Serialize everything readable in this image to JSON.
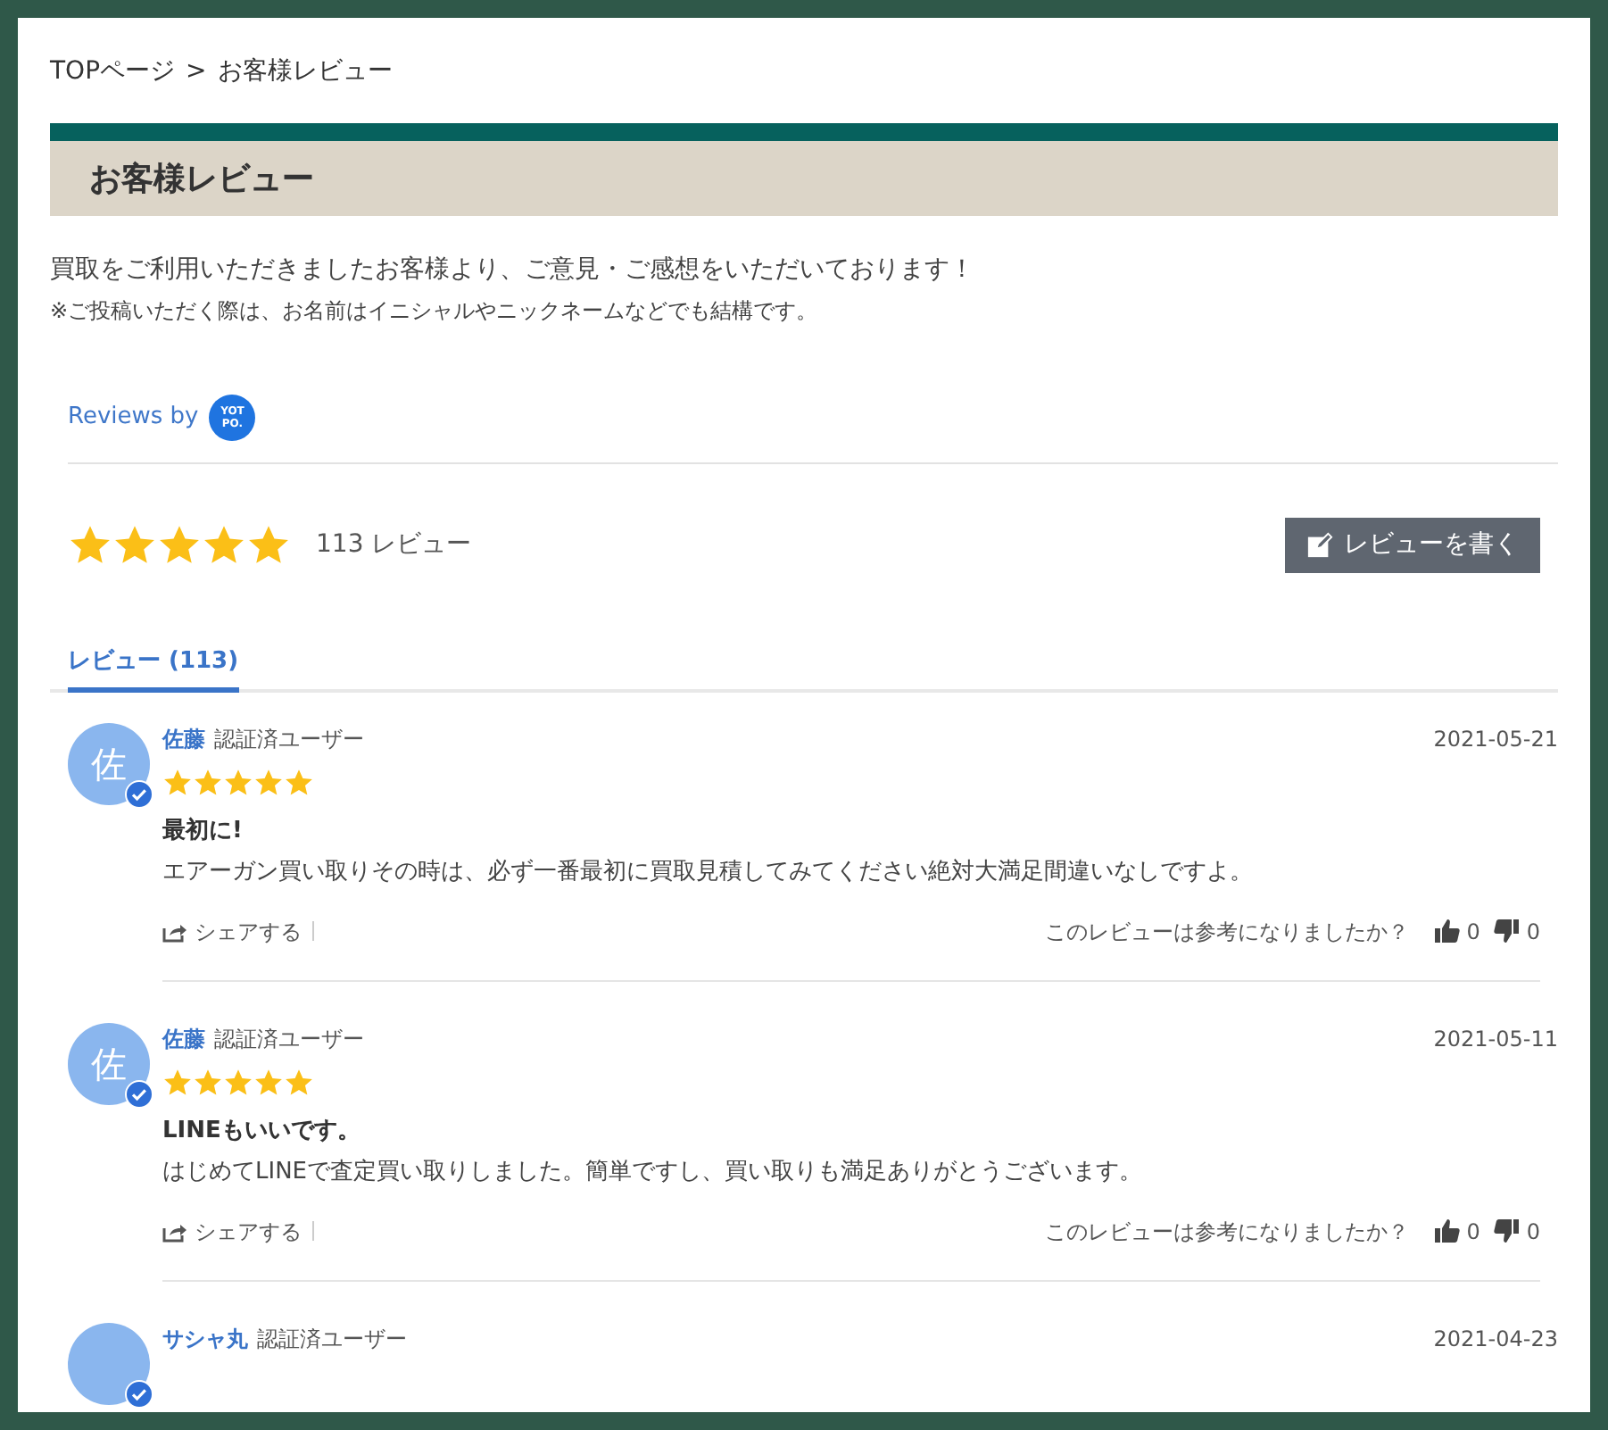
{
  "breadcrumb": {
    "items": [
      "TOPページ",
      "お客様レビュー"
    ],
    "separator": ">"
  },
  "page_title": "お客様レビュー",
  "intro": "買取をご利用いただきましたお客様より、ご意見・ご感想をいただいております！",
  "note": "※ご投稿いただく際は、お名前はイニシャルやニックネームなどでも結構です。",
  "powered_by": {
    "label": "Reviews by",
    "logo_lines": [
      "YOT",
      "PO."
    ]
  },
  "summary": {
    "stars": 5,
    "count": "113 レビュー",
    "write_button": "レビューを書く"
  },
  "tabs": [
    {
      "label": "レビュー (113)",
      "selected": true
    }
  ],
  "reviews": [
    {
      "initial": "佐",
      "name": "佐藤",
      "badge": "認証済ユーザー",
      "verified": true,
      "date": "2021-05-21",
      "stars": 5,
      "title": "最初に!",
      "body": "エアーガン買い取りその時は、必ず一番最初に買取見積してみてください絶対大満足間違いなしですよ。",
      "share": "シェアする",
      "helpful": "このレビューは参考になりましたか？",
      "up": "0",
      "down": "0"
    },
    {
      "initial": "佐",
      "name": "佐藤",
      "badge": "認証済ユーザー",
      "verified": true,
      "date": "2021-05-11",
      "stars": 5,
      "title": "LINEもいいです。",
      "body": "はじめてLINEで査定買い取りしました。簡単ですし、買い取りも満足ありがとうございます。",
      "share": "シェアする",
      "helpful": "このレビューは参考になりましたか？",
      "up": "0",
      "down": "0"
    },
    {
      "name": "サシャ丸",
      "badge": "認証済ユーザー",
      "verified": true,
      "date": "2021-04-23"
    }
  ]
}
